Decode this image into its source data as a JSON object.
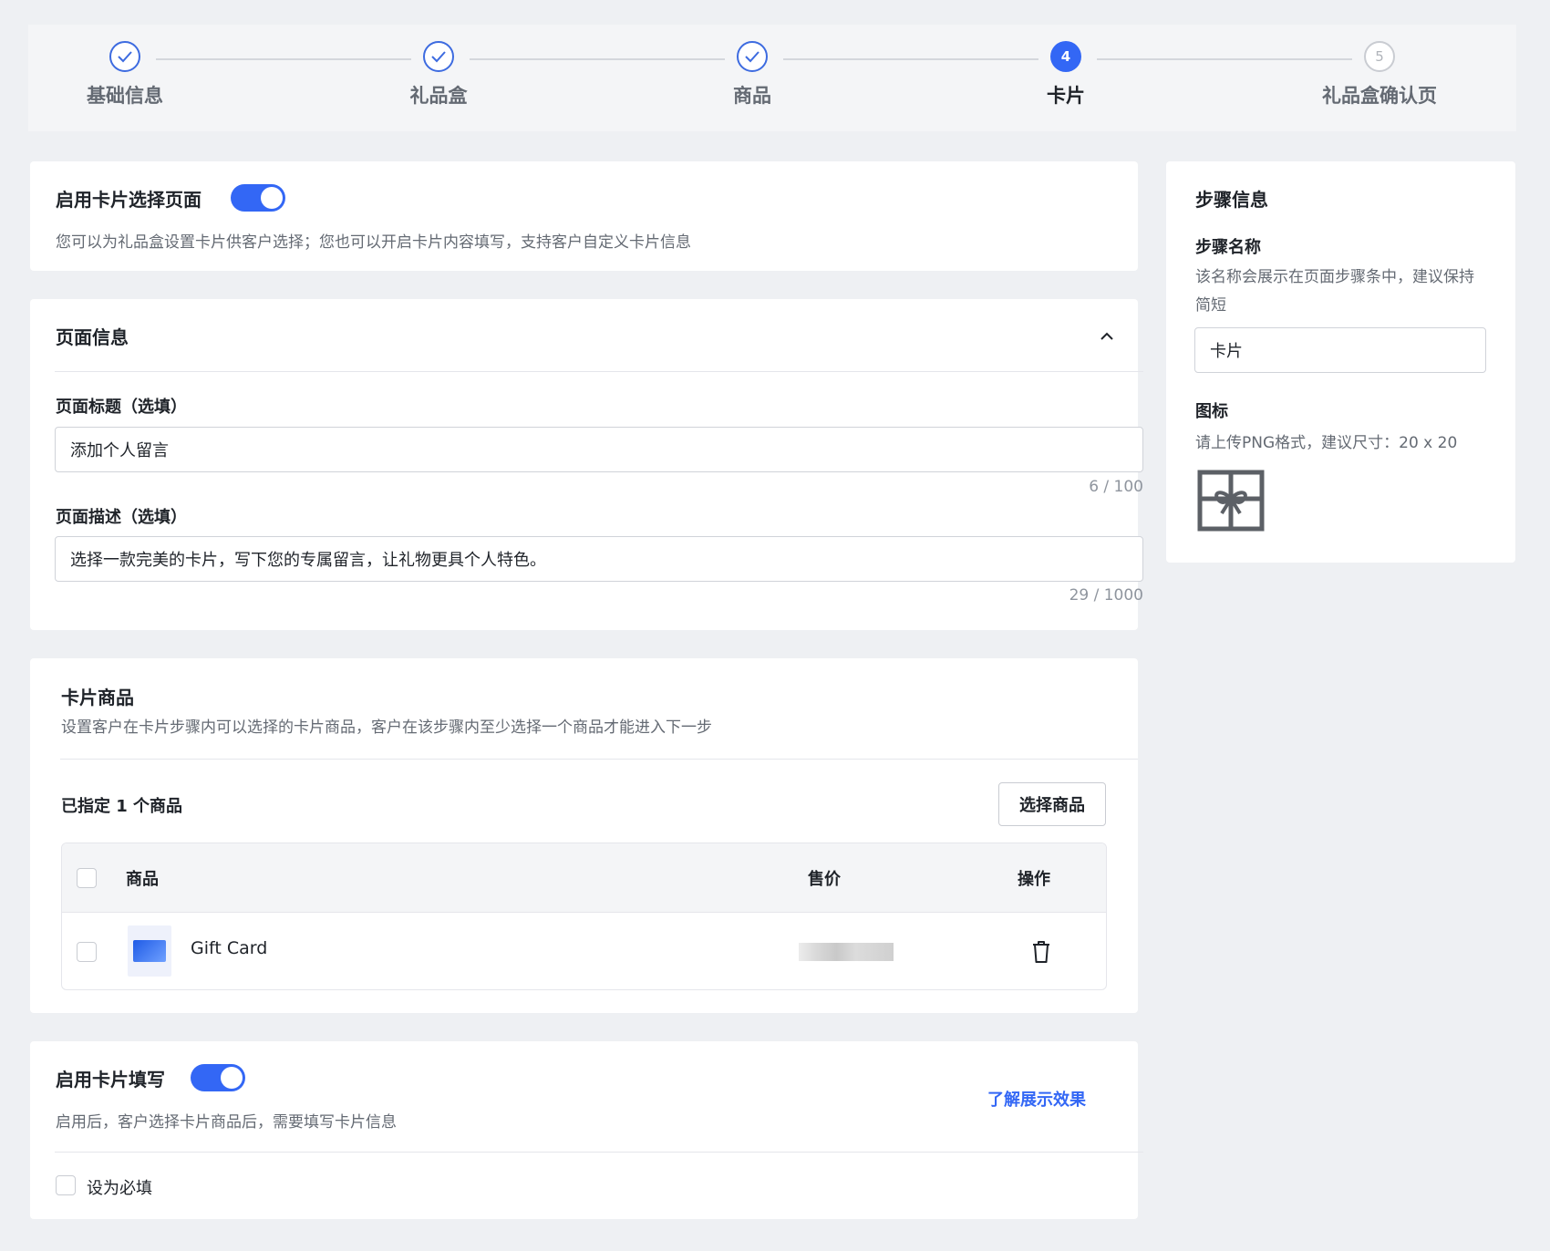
{
  "steps": [
    {
      "label": "基础信息",
      "state": "done"
    },
    {
      "label": "礼品盒",
      "state": "done"
    },
    {
      "label": "商品",
      "state": "done"
    },
    {
      "label": "卡片",
      "state": "current",
      "number": "4"
    },
    {
      "label": "礼品盒确认页",
      "state": "todo",
      "number": "5"
    }
  ],
  "card_select": {
    "title": "启用卡片选择页面",
    "enabled": true,
    "description": "您可以为礼品盒设置卡片供客户选择；您也可以开启卡片内容填写，支持客户自定义卡片信息"
  },
  "page_info": {
    "title": "页面信息",
    "title_label": "页面标题（选填）",
    "title_value": "添加个人留言",
    "title_counter": "6 / 100",
    "desc_label": "页面描述（选填）",
    "desc_value": "选择一款完美的卡片，写下您的专属留言，让礼物更具个人特色。",
    "desc_counter": "29 / 1000"
  },
  "card_products": {
    "title": "卡片商品",
    "description": "设置客户在卡片步骤内可以选择的卡片商品，客户在该步骤内至少选择一个商品才能进入下一步",
    "assigned_text": "已指定 1 个商品",
    "select_button": "选择商品",
    "columns": {
      "product": "商品",
      "price": "售价",
      "action": "操作"
    },
    "rows": [
      {
        "name": "Gift Card"
      }
    ]
  },
  "card_fill": {
    "title": "启用卡片填写",
    "enabled": true,
    "description": "启用后，客户选择卡片商品后，需要填写卡片信息",
    "preview_link": "了解展示效果",
    "required_label": "设为必填"
  },
  "step_info": {
    "title": "步骤信息",
    "name_label": "步骤名称",
    "name_desc": "该名称会展示在页面步骤条中，建议保持简短",
    "name_value": "卡片",
    "icon_label": "图标",
    "icon_desc": "请上传PNG格式，建议尺寸：20 x 20"
  },
  "colors": {
    "accent": "#3367f5",
    "background": "#eef0f3"
  }
}
